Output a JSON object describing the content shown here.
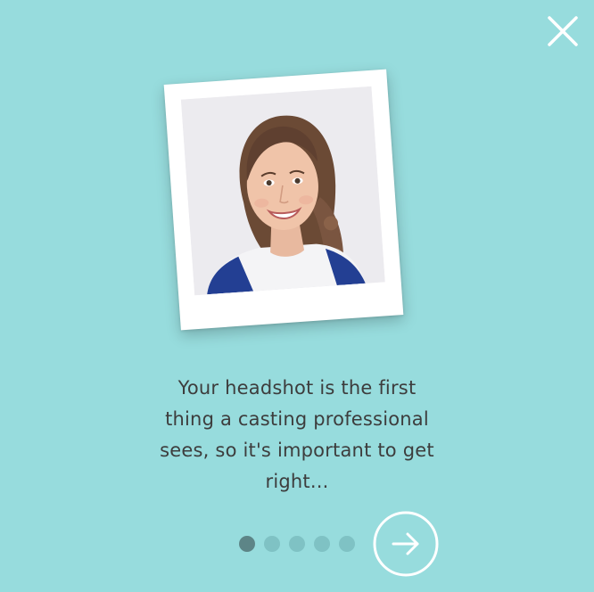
{
  "onboarding": {
    "caption": "Your headshot is the first\nthing a casting professional\nsees, so it's important to get\nright...",
    "close_icon": "close-icon",
    "next_icon": "arrow-right-icon",
    "pagination": {
      "total": 5,
      "current": 1
    }
  },
  "colors": {
    "background": "#97dcdd",
    "dot_active": "#5d8587",
    "dot_inactive": "#7fc2c4",
    "text": "#3d3d3d",
    "icon": "#ffffff"
  }
}
